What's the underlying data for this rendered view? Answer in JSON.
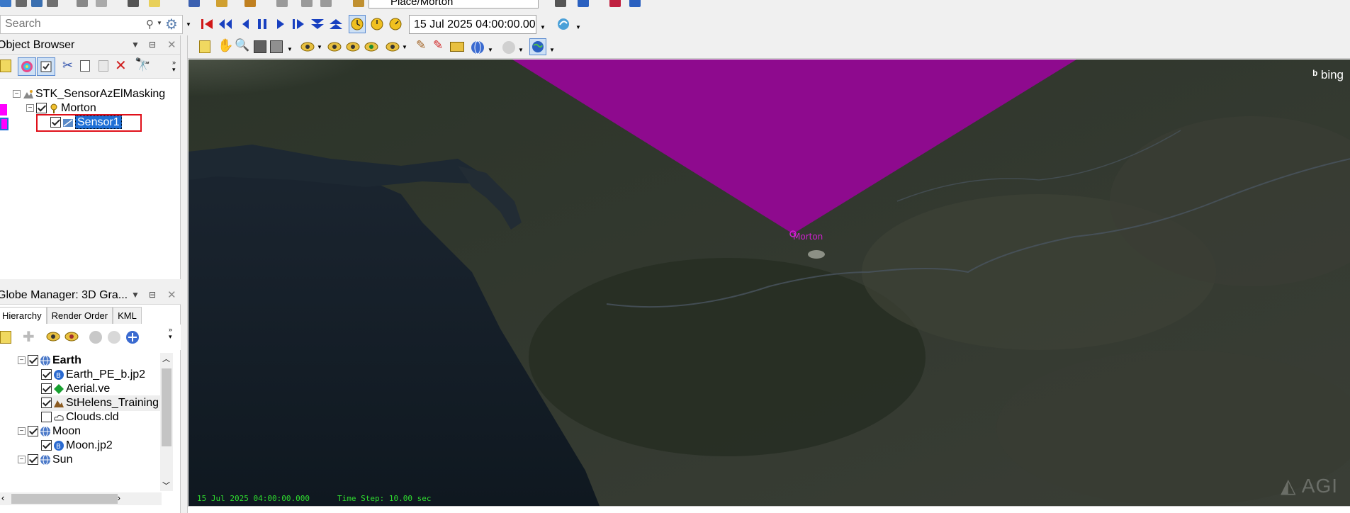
{
  "toolbar": {
    "scenario_path": "Place/Morton",
    "search_placeholder": "Search",
    "animation_time": "15 Jul 2025 04:00:00.000"
  },
  "object_browser": {
    "title": "Object Browser",
    "tree": [
      {
        "label": "STK_SensorAzElMasking",
        "checked": false
      },
      {
        "label": "Morton",
        "checked": true,
        "color": "#ff00ff"
      },
      {
        "label": "Sensor1",
        "checked": true,
        "selected": true,
        "color": "#ff00ff"
      }
    ]
  },
  "globe_manager": {
    "title": "Globe Manager: 3D Gra...",
    "tabs": [
      "Hierarchy",
      "Render Order",
      "KML"
    ],
    "tree": [
      {
        "label": "Earth",
        "checked": true,
        "bold": true
      },
      {
        "label": "Earth_PE_b.jp2",
        "checked": true
      },
      {
        "label": "Aerial.ve",
        "checked": true
      },
      {
        "label": "StHelens_Training",
        "checked": true
      },
      {
        "label": "Clouds.cld",
        "checked": false
      },
      {
        "label": "Moon",
        "checked": true
      },
      {
        "label": "Moon.jp2",
        "checked": true
      },
      {
        "label": "Sun",
        "checked": true
      }
    ]
  },
  "viewport": {
    "date_overlay": "15 Jul 2025 04:00:00.000",
    "time_step_overlay": "Time Step: 10.00 sec",
    "target_label": "Morton",
    "bing_label": "bing",
    "agi_label": "AGI",
    "sensor_color": "#8e0a8e"
  }
}
